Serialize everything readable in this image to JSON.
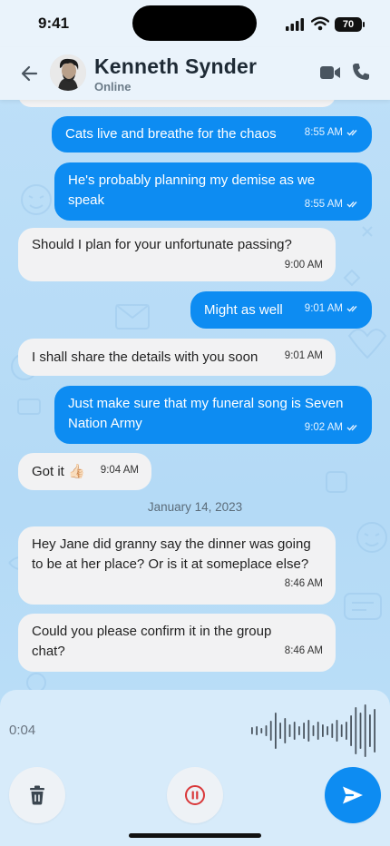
{
  "status_bar": {
    "time": "9:41",
    "battery": "70"
  },
  "header": {
    "contact_name": "Kenneth Synder",
    "contact_status": "Online",
    "icons": [
      "back-arrow-icon",
      "video-camera-icon",
      "phone-icon"
    ]
  },
  "messages": [
    {
      "direction": "out",
      "text": "Cats live and breathe for the chaos",
      "time": "8:55 AM",
      "read": true
    },
    {
      "direction": "out",
      "text": "He's probably planning my demise as we speak",
      "time": "8:55 AM",
      "read": true
    },
    {
      "direction": "in",
      "text": "Should I plan for your unfortunate passing?",
      "time": "9:00 AM"
    },
    {
      "direction": "out",
      "text": "Might as well",
      "time": "9:01 AM",
      "read": true
    },
    {
      "direction": "in",
      "text": "I shall share the details with you soon",
      "time": "9:01 AM"
    },
    {
      "direction": "out",
      "text": "Just make sure that my funeral song is Seven Nation Army",
      "time": "9:02 AM",
      "read": true
    },
    {
      "direction": "in",
      "text": "Got it 👍🏻",
      "time": "9:04 AM"
    },
    {
      "direction": "in",
      "text": "Hey Jane did granny say the dinner was going to be at her place? Or is it at someplace else?",
      "time": "8:46 AM"
    },
    {
      "direction": "in",
      "text": "Could you please confirm it in the group chat?",
      "time": "8:46 AM"
    }
  ],
  "date_separator": "January 14, 2023",
  "recorder": {
    "elapsed": "0:04",
    "icons": [
      "trash-icon",
      "pause-icon",
      "send-icon"
    ]
  },
  "colors": {
    "outgoing_bubble": "#0d8cf2",
    "incoming_bubble": "#f2f2f3",
    "chat_background": "#b9dcf7",
    "accent": "#0d8cf2",
    "pause_red": "#d9383a"
  }
}
